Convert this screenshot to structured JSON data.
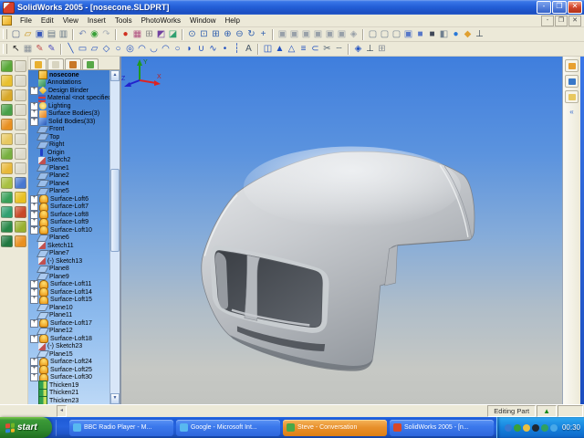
{
  "window": {
    "title": "SolidWorks 2005 - [nosecone.SLDPRT]"
  },
  "titlebar": {
    "minimize": "-",
    "restore": "❐",
    "close": "✕"
  },
  "menu": {
    "items": [
      "File",
      "Edit",
      "View",
      "Insert",
      "Tools",
      "PhotoWorks",
      "Window",
      "Help"
    ],
    "child_controls": [
      "-",
      "❐",
      "✕"
    ]
  },
  "toolbars": {
    "standard": [
      {
        "n": "new",
        "g": "▢",
        "c": "#556688"
      },
      {
        "n": "open",
        "g": "▱",
        "c": "#C89018"
      },
      {
        "n": "save",
        "g": "▣",
        "c": "#3858B8"
      },
      {
        "n": "print",
        "g": "▤",
        "c": "#667788"
      },
      {
        "n": "print-preview",
        "g": "▥",
        "c": "#667788"
      },
      {
        "sep": 1
      },
      {
        "n": "undo",
        "g": "↶",
        "c": "#7A8CB8"
      },
      {
        "n": "rebuild",
        "g": "◉",
        "c": "#38A038"
      },
      {
        "n": "redo",
        "g": "↷",
        "c": "#AAB0B8"
      },
      {
        "sep": 1
      },
      {
        "n": "stop-light",
        "g": "●",
        "c": "#D03020"
      },
      {
        "n": "color-swatch",
        "g": "▦",
        "c": "#B05080"
      },
      {
        "n": "options",
        "g": "⊞",
        "c": "#888888"
      },
      {
        "n": "photoworks-render",
        "g": "◩",
        "c": "#7040A0"
      },
      {
        "n": "photoworks-preview",
        "g": "◪",
        "c": "#30A070"
      },
      {
        "sep": 1
      },
      {
        "n": "zoom-previous",
        "g": "⊙",
        "c": "#3060B0"
      },
      {
        "n": "zoom-fit",
        "g": "⊡",
        "c": "#3060B0"
      },
      {
        "n": "zoom-area",
        "g": "⊞",
        "c": "#3060B0"
      },
      {
        "n": "zoom-in-out",
        "g": "⊕",
        "c": "#3060B0"
      },
      {
        "n": "zoom-selection",
        "g": "⊖",
        "c": "#3060B0"
      },
      {
        "n": "rotate-view",
        "g": "↻",
        "c": "#3060B0"
      },
      {
        "n": "pan",
        "g": "+",
        "c": "#3060B0"
      },
      {
        "sep": 1
      },
      {
        "n": "view-front",
        "g": "▣",
        "c": "#98A0A8"
      },
      {
        "n": "view-back",
        "g": "▣",
        "c": "#98A0A8"
      },
      {
        "n": "view-left",
        "g": "▣",
        "c": "#98A0A8"
      },
      {
        "n": "view-right",
        "g": "▣",
        "c": "#98A0A8"
      },
      {
        "n": "view-top",
        "g": "▣",
        "c": "#98A0A8"
      },
      {
        "n": "view-bottom",
        "g": "▣",
        "c": "#98A0A8"
      },
      {
        "n": "view-isometric",
        "g": "◈",
        "c": "#98A0A8"
      },
      {
        "sep": 1
      },
      {
        "n": "wireframe",
        "g": "▢",
        "c": "#708090"
      },
      {
        "n": "hidden-lines-visible",
        "g": "▢",
        "c": "#708090"
      },
      {
        "n": "hidden-lines-removed",
        "g": "▢",
        "c": "#708090"
      },
      {
        "n": "shaded-with-edges",
        "g": "▣",
        "c": "#5878C8"
      },
      {
        "n": "shaded",
        "g": "■",
        "c": "#5878C8"
      },
      {
        "n": "shadows",
        "g": "■",
        "c": "#404858"
      },
      {
        "n": "section-view",
        "g": "◧",
        "c": "#708090"
      },
      {
        "n": "realview-sphere",
        "g": "●",
        "c": "#2878D8"
      },
      {
        "n": "curvature",
        "g": "◆",
        "c": "#E0A030"
      },
      {
        "n": "normal-to",
        "g": "⊥",
        "c": "#334455"
      }
    ],
    "sketch": [
      {
        "n": "select",
        "g": "↖",
        "c": "#222222"
      },
      {
        "n": "grid",
        "g": "▦",
        "c": "#889099"
      },
      {
        "n": "sketch",
        "g": "✎",
        "c": "#C05050"
      },
      {
        "n": "3d-sketch",
        "g": "✎",
        "c": "#5050C0"
      },
      {
        "sep": 1
      },
      {
        "n": "line",
        "g": "╲",
        "c": "#2050C0"
      },
      {
        "n": "rectangle",
        "g": "▭",
        "c": "#2050C0"
      },
      {
        "n": "parallelogram",
        "g": "▱",
        "c": "#2050C0"
      },
      {
        "n": "polygon",
        "g": "◇",
        "c": "#2050C0"
      },
      {
        "n": "circle",
        "g": "○",
        "c": "#2050C0"
      },
      {
        "n": "perimeter-circle",
        "g": "◎",
        "c": "#2050C0"
      },
      {
        "n": "centerpoint-arc",
        "g": "◠",
        "c": "#2050C0"
      },
      {
        "n": "tangent-arc",
        "g": "◡",
        "c": "#2050C0"
      },
      {
        "n": "three-point-arc",
        "g": "◠",
        "c": "#2050C0"
      },
      {
        "n": "ellipse",
        "g": "○",
        "c": "#2050C0"
      },
      {
        "n": "partial-ellipse",
        "g": "◗",
        "c": "#2050C0"
      },
      {
        "n": "parabola",
        "g": "∪",
        "c": "#2050C0"
      },
      {
        "n": "spline",
        "g": "∿",
        "c": "#2050C0"
      },
      {
        "n": "point",
        "g": "•",
        "c": "#2050C0"
      },
      {
        "n": "centerline",
        "g": "┆",
        "c": "#2050C0"
      },
      {
        "n": "text",
        "g": "A",
        "c": "#445566"
      },
      {
        "sep": 1
      },
      {
        "n": "mirror",
        "g": "◫",
        "c": "#2050C0"
      },
      {
        "n": "dynamic-mirror",
        "g": "▲",
        "c": "#2050C0"
      },
      {
        "n": "fillet-sketch",
        "g": "△",
        "c": "#2050C0"
      },
      {
        "n": "offset-entities",
        "g": "≡",
        "c": "#2050C0"
      },
      {
        "n": "convert-entities",
        "g": "⊂",
        "c": "#2050C0"
      },
      {
        "n": "trim",
        "g": "✂",
        "c": "#556677"
      },
      {
        "n": "construction-geometry",
        "g": "┄",
        "c": "#556677"
      },
      {
        "sep": 1
      },
      {
        "n": "quick-snaps",
        "g": "◈",
        "c": "#2050C0"
      },
      {
        "n": "sketch-normal",
        "g": "⊥",
        "c": "#334455"
      },
      {
        "n": "modify-sketch",
        "g": "⊞",
        "c": "#889099"
      }
    ],
    "left_col1": [
      {
        "n": "extruded-boss",
        "c": "#58A838"
      },
      {
        "n": "revolved-boss",
        "c": "#E8C030"
      },
      {
        "n": "swept-boss",
        "c": "#D8A828"
      },
      {
        "n": "lofted-boss",
        "c": "#48A048"
      },
      {
        "n": "extruded-cut",
        "c": "#E89020"
      },
      {
        "n": "revolved-cut",
        "c": "#E8C860"
      },
      {
        "n": "swept-cut",
        "c": "#78B040"
      },
      {
        "n": "lofted-cut",
        "c": "#E8B838"
      },
      {
        "n": "fillet",
        "c": "#A8C040"
      },
      {
        "n": "chamfer",
        "c": "#38A058"
      },
      {
        "n": "shell",
        "c": "#30A070"
      },
      {
        "n": "linear-pattern",
        "c": "#288848"
      },
      {
        "n": "circular-pattern",
        "c": "#207840"
      }
    ],
    "left_col2": [
      {
        "n": "ref-view-1",
        "c": "#DDDACA"
      },
      {
        "n": "ref-view-2",
        "c": "#DDDACA"
      },
      {
        "n": "ref-view-3",
        "c": "#DDDACA"
      },
      {
        "n": "ref-view-4",
        "c": "#DDDACA"
      },
      {
        "n": "ref-view-5",
        "c": "#DDDACA"
      },
      {
        "n": "ref-view-6",
        "c": "#DDDACA"
      },
      {
        "n": "ref-view-7",
        "c": "#DDDACA"
      },
      {
        "n": "ref-view-8",
        "c": "#DDDACA"
      },
      {
        "n": "extruded-surface",
        "c": "#4878D0"
      },
      {
        "n": "revolved-surface",
        "c": "#E8C020"
      },
      {
        "n": "swept-surface",
        "c": "#C84828"
      },
      {
        "n": "lofted-surface",
        "c": "#98B030"
      },
      {
        "n": "planar-surface",
        "c": "#E89020"
      }
    ],
    "panel_tabs": [
      {
        "n": "featuremanager-tree-tab",
        "c": "#E8B030"
      },
      {
        "n": "propertymanager-tab",
        "c": "#D8D4C0"
      },
      {
        "n": "configurationmanager-tab",
        "c": "#C87828"
      },
      {
        "n": "dimxpert-tab",
        "c": "#58A848"
      }
    ],
    "taskpane_icons": [
      {
        "n": "solidworks-resources-icon",
        "c": "#E8A030"
      },
      {
        "n": "design-library-icon",
        "c": "#3878C8"
      },
      {
        "n": "file-explorer-icon",
        "c": "#E8C860"
      }
    ],
    "taskpane_chevron": "«"
  },
  "feature_tree": {
    "root": "nosecone",
    "items": [
      {
        "l": "Annotations",
        "t": "ann"
      },
      {
        "l": "Design Binder",
        "t": "binder",
        "p": 1
      },
      {
        "l": "Material <not specified>",
        "t": "mat"
      },
      {
        "l": "Lighting",
        "t": "light",
        "p": 1
      },
      {
        "l": "Surface Bodies(3)",
        "t": "surf",
        "p": 1
      },
      {
        "l": "Solid Bodies(33)",
        "t": "solid",
        "p": 1
      },
      {
        "l": "Front",
        "t": "plane"
      },
      {
        "l": "Top",
        "t": "plane"
      },
      {
        "l": "Right",
        "t": "plane"
      },
      {
        "l": "Origin",
        "t": "origin"
      },
      {
        "l": "Sketch2",
        "t": "sketch"
      },
      {
        "l": "Plane1",
        "t": "plane"
      },
      {
        "l": "Plane2",
        "t": "plane"
      },
      {
        "l": "Plane4",
        "t": "plane"
      },
      {
        "l": "Plane5",
        "t": "plane"
      },
      {
        "l": "Surface-Loft6",
        "t": "loft",
        "p": 1
      },
      {
        "l": "Surface-Loft7",
        "t": "loft",
        "p": 1
      },
      {
        "l": "Surface-Loft8",
        "t": "loft",
        "p": 1
      },
      {
        "l": "Surface-Loft9",
        "t": "loft",
        "p": 1
      },
      {
        "l": "Surface-Loft10",
        "t": "loft",
        "p": 1
      },
      {
        "l": "Plane6",
        "t": "plane"
      },
      {
        "l": "Sketch11",
        "t": "sketch"
      },
      {
        "l": "Plane7",
        "t": "plane"
      },
      {
        "l": "(-) Sketch13",
        "t": "sketch"
      },
      {
        "l": "Plane8",
        "t": "plane"
      },
      {
        "l": "Plane9",
        "t": "plane"
      },
      {
        "l": "Surface-Loft11",
        "t": "loft",
        "p": 1
      },
      {
        "l": "Surface-Loft14",
        "t": "loft",
        "p": 1
      },
      {
        "l": "Surface-Loft15",
        "t": "loft",
        "p": 1
      },
      {
        "l": "Plane10",
        "t": "plane"
      },
      {
        "l": "Plane11",
        "t": "plane"
      },
      {
        "l": "Surface-Loft17",
        "t": "loft",
        "p": 1
      },
      {
        "l": "Plane12",
        "t": "plane"
      },
      {
        "l": "Surface-Loft18",
        "t": "loft",
        "p": 1
      },
      {
        "l": "(-) Sketch23",
        "t": "sketch"
      },
      {
        "l": "Plane15",
        "t": "plane"
      },
      {
        "l": "Surface-Loft24",
        "t": "loft",
        "p": 1
      },
      {
        "l": "Surface-Loft25",
        "t": "loft",
        "p": 1
      },
      {
        "l": "Surface-Loft30",
        "t": "loft",
        "p": 1
      },
      {
        "l": "Thicken19",
        "t": "thicken"
      },
      {
        "l": "Thicken21",
        "t": "thicken"
      },
      {
        "l": "Thicken23",
        "t": "thicken"
      }
    ]
  },
  "viewport": {
    "triad": {
      "x": "X",
      "y": "Y",
      "z": "Z"
    }
  },
  "status": {
    "mode": "Editing Part"
  },
  "taskbar": {
    "start_label": "start",
    "buttons": [
      {
        "label": "BBC Radio Player - M...",
        "ic": "#58b8f0",
        "hl": 0
      },
      {
        "label": "Google - Microsoft Int...",
        "ic": "#58b8f0",
        "hl": 0
      },
      {
        "label": "Steve - Conversation",
        "ic": "#48a848",
        "hl": 1
      },
      {
        "label": "SolidWorks 2005 - [n...",
        "ic": "#d84828",
        "hl": 0
      }
    ],
    "tray_icons": [
      {
        "n": "network-icon",
        "c": "#3878D0"
      },
      {
        "n": "msn-messenger-icon",
        "c": "#38A038"
      },
      {
        "n": "user-status-icon",
        "c": "#E8C040"
      },
      {
        "n": "media-player-icon",
        "c": "#202830"
      },
      {
        "n": "antivirus-icon",
        "c": "#30A060"
      },
      {
        "n": "windows-update-icon",
        "c": "#48A8E8"
      }
    ],
    "clock": "00:30"
  }
}
